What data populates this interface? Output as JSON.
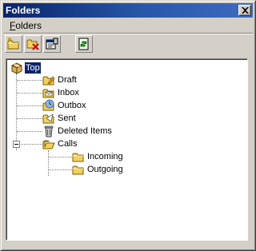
{
  "window": {
    "title": "Folders"
  },
  "menu": {
    "items": [
      {
        "label_underlined": "F",
        "label_rest": "olders"
      }
    ]
  },
  "toolbar": {
    "buttons": [
      {
        "name": "new-folder-icon"
      },
      {
        "name": "delete-folder-icon"
      },
      {
        "name": "properties-icon"
      },
      {
        "name": "refresh-icon"
      }
    ]
  },
  "tree": {
    "root": {
      "label": "Top",
      "icon": "folder-box-icon",
      "selected": true
    },
    "children": [
      {
        "label": "Draft",
        "icon": "draft-folder-icon"
      },
      {
        "label": "Inbox",
        "icon": "inbox-folder-icon"
      },
      {
        "label": "Outbox",
        "icon": "outbox-folder-icon"
      },
      {
        "label": "Sent",
        "icon": "sent-folder-icon"
      },
      {
        "label": "Deleted Items",
        "icon": "trash-icon"
      },
      {
        "label": "Calls",
        "icon": "calls-folder-icon",
        "expanded": true,
        "children": [
          {
            "label": "Incoming",
            "icon": "incoming-folder-icon"
          },
          {
            "label": "Outgoing",
            "icon": "outgoing-folder-icon"
          }
        ]
      }
    ]
  },
  "colors": {
    "titlebar_start": "#0a246a",
    "titlebar_end": "#3d6cc0",
    "selection": "#0a246a",
    "chrome": "#d4d0c8"
  }
}
